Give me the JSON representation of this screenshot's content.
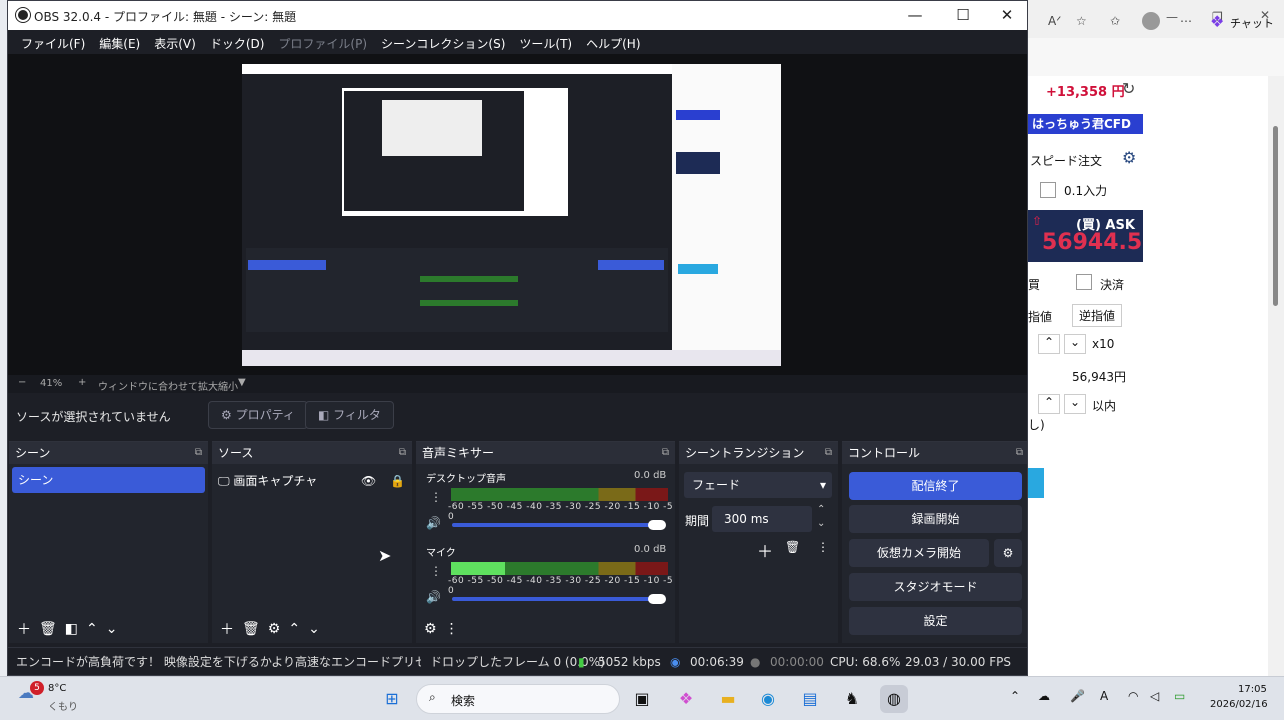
{
  "window": {
    "title": "OBS 32.0.4 - プロファイル: 無題 - シーン: 無題",
    "minimize": "—",
    "maximize": "☐",
    "close": "✕"
  },
  "menu": [
    "ファイル(F)",
    "編集(E)",
    "表示(V)",
    "ドック(D)",
    "プロファイル(P)",
    "シーンコレクション(S)",
    "ツール(T)",
    "ヘルプ(H)"
  ],
  "zoom": {
    "minus": "−",
    "value": "41%",
    "plus": "+",
    "mode": "ウィンドウに合わせて拡大縮小"
  },
  "source_bar": {
    "message": "ソースが選択されていません",
    "properties": "プロパティ",
    "filters": "フィルタ"
  },
  "scenes": {
    "title": "シーン",
    "items": [
      "シーン"
    ]
  },
  "sources": {
    "title": "ソース",
    "items": [
      "画面キャプチャ"
    ]
  },
  "mixer": {
    "title": "音声ミキサー",
    "channels": [
      {
        "name": "デスクトップ音声",
        "db": "0.0 dB",
        "level": 0.0
      },
      {
        "name": "マイク",
        "db": "0.0 dB",
        "level": 0.25
      }
    ],
    "scale": "-60 -55 -50 -45 -40 -35 -30 -25 -20 -15 -10 -5 0"
  },
  "transitions": {
    "title": "シーントランジション",
    "selected": "フェード",
    "duration_label": "期間",
    "duration": "300 ms"
  },
  "controls": {
    "title": "コントロール",
    "stream": "配信終了",
    "record": "録画開始",
    "vcam": "仮想カメラ開始",
    "studio": "スタジオモード",
    "settings": "設定"
  },
  "status": {
    "warning": "エンコードが高負荷です！ 映像設定を下げるかより高速なエンコードプリセットの使用!",
    "dropped": "ドロップしたフレーム 0 (0.0%)",
    "bitrate": "5052 kbps",
    "stream_time": "00:06:39",
    "rec_time": "00:00:00",
    "cpu": "CPU: 68.6%",
    "fps": "29.03 / 30.00 FPS"
  },
  "browser": {
    "chat": "チャット",
    "profit": "+13,358 円",
    "banner": "はっちゅう君CFD",
    "speed_order": "スピード注文",
    "lot": "0.1入力",
    "ask_label": "(買) ASK",
    "ask": "56944.5",
    "buy": "買",
    "settle": "決済",
    "limit": "指値",
    "stop": "逆指値",
    "mult": "x10",
    "price": "56,943円",
    "within": "以内",
    "note": "し)"
  },
  "taskbar": {
    "weather_temp": "8°C",
    "weather_desc": "くもり",
    "badge": "5",
    "search": "検索",
    "time": "17:05",
    "date": "2026/02/16"
  }
}
